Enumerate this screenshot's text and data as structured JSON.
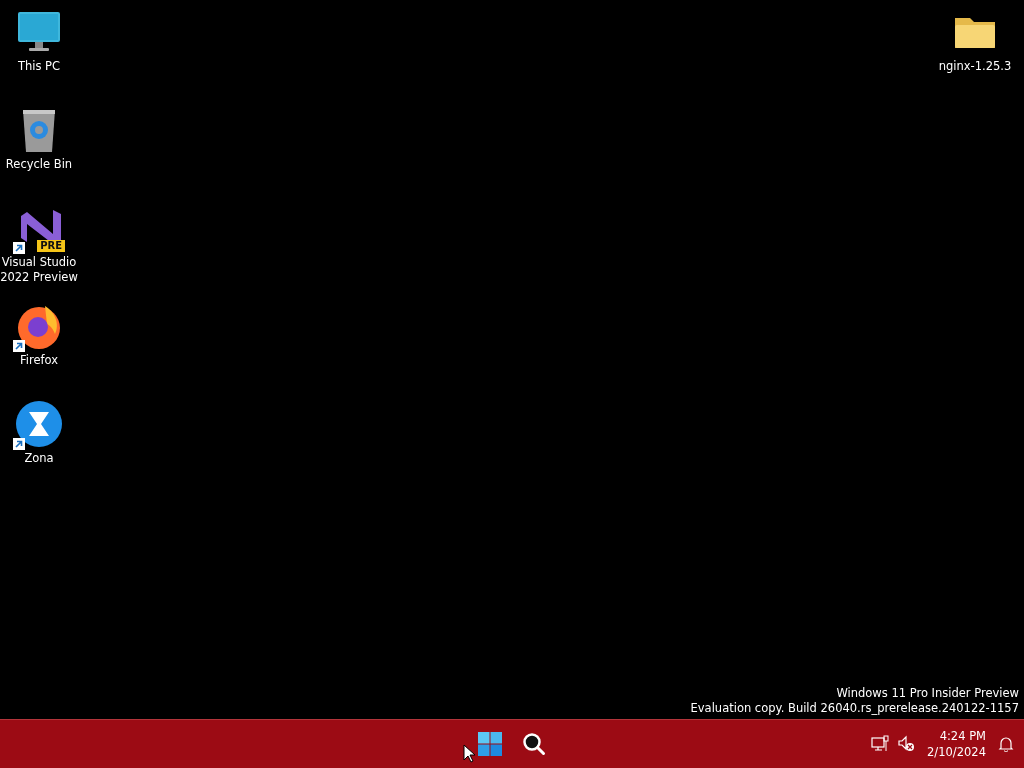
{
  "desktop_icons_left": [
    {
      "kind": "monitor",
      "label": "This PC",
      "shortcut": false
    },
    {
      "kind": "recycle-bin",
      "label": "Recycle Bin",
      "shortcut": false
    },
    {
      "kind": "visual-studio",
      "label": "Visual Studio 2022 Preview",
      "badge": "PRE",
      "shortcut": true
    },
    {
      "kind": "firefox",
      "label": "Firefox",
      "shortcut": true
    },
    {
      "kind": "zona",
      "label": "Zona",
      "shortcut": true
    }
  ],
  "desktop_icons_right": [
    {
      "kind": "folder",
      "label": "nginx-1.25.3",
      "shortcut": false
    }
  ],
  "watermark": {
    "line_1": "Windows 11 Pro Insider Preview",
    "line_2": "Evaluation copy. Build 26040.rs_prerelease.240122-1157"
  },
  "taskbar": {
    "time": "4:24 PM",
    "date": "2/10/2024"
  }
}
